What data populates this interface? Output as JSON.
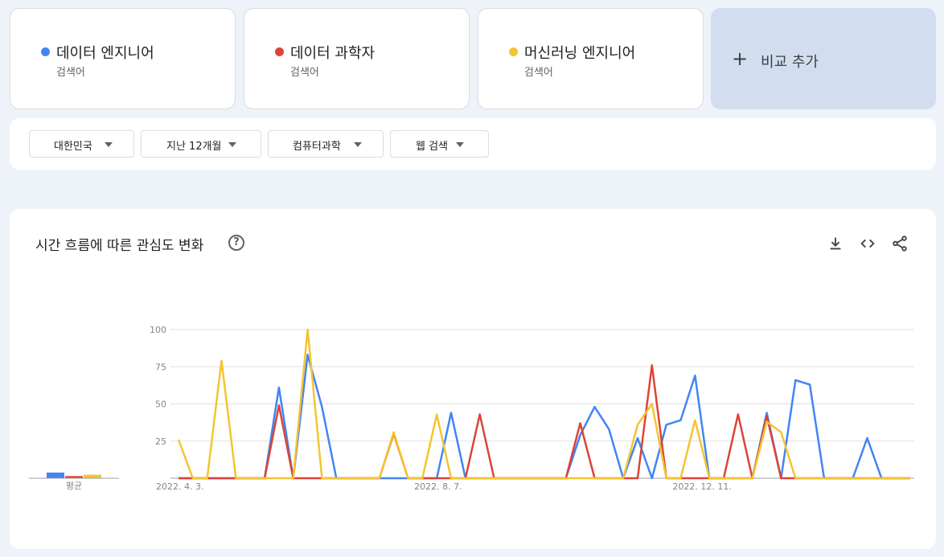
{
  "terms": [
    {
      "name": "데이터 엔지니어",
      "sub": "검색어",
      "color": "#4285f4"
    },
    {
      "name": "데이터 과학자",
      "sub": "검색어",
      "color": "#db4437"
    },
    {
      "name": "머신러닝 엔지니어",
      "sub": "검색어",
      "color": "#f4b400"
    }
  ],
  "add_compare": {
    "icon": "plus-icon",
    "label": "비교 추가"
  },
  "filters": [
    {
      "label": "대한민국",
      "icon": "caret-down-icon"
    },
    {
      "label": "지난 12개월",
      "icon": "caret-down-icon"
    },
    {
      "label": "컴퓨터과학",
      "icon": "caret-down-icon"
    },
    {
      "label": "웹 검색",
      "icon": "caret-down-icon"
    }
  ],
  "chart_card": {
    "title": "시간 흐름에 따른 관심도 변화",
    "help_icon": "help-circle-icon",
    "actions": [
      "download-icon",
      "embed-code-icon",
      "share-icon"
    ]
  },
  "chart_data": {
    "type": "line",
    "ylim": [
      0,
      100
    ],
    "yticks": [
      25,
      50,
      75,
      100
    ],
    "xtick_labels": [
      {
        "label": "2022. 4. 3.",
        "index": 0
      },
      {
        "label": "2022. 8. 7.",
        "index": 18
      },
      {
        "label": "2022. 12. 11.",
        "index": 36
      }
    ],
    "grid": true,
    "series": [
      {
        "name": "데이터 엔지니어",
        "color": "#4285f4",
        "values": [
          0,
          0,
          0,
          0,
          0,
          0,
          0,
          61,
          0,
          83,
          48,
          0,
          0,
          0,
          0,
          0,
          0,
          0,
          0,
          44,
          0,
          0,
          0,
          0,
          0,
          0,
          0,
          0,
          0,
          0,
          0,
          0,
          0,
          0,
          0,
          0,
          0,
          0,
          0,
          0,
          0,
          0,
          0,
          0,
          0,
          0,
          0,
          0,
          0,
          0,
          0,
          0,
          0,
          0,
          0,
          0,
          0,
          0,
          0,
          0,
          0,
          0,
          0,
          0,
          0,
          0,
          0,
          0,
          0,
          0,
          0,
          0,
          0,
          0,
          0,
          0
        ]
      },
      {
        "name": "데이터 과학자",
        "color": "#db4437",
        "values": []
      },
      {
        "name": "머신러닝 엔지니어",
        "color": "#f4b400",
        "values": []
      }
    ],
    "average": {
      "label": "평균",
      "values": [
        13,
        5,
        8
      ]
    }
  }
}
